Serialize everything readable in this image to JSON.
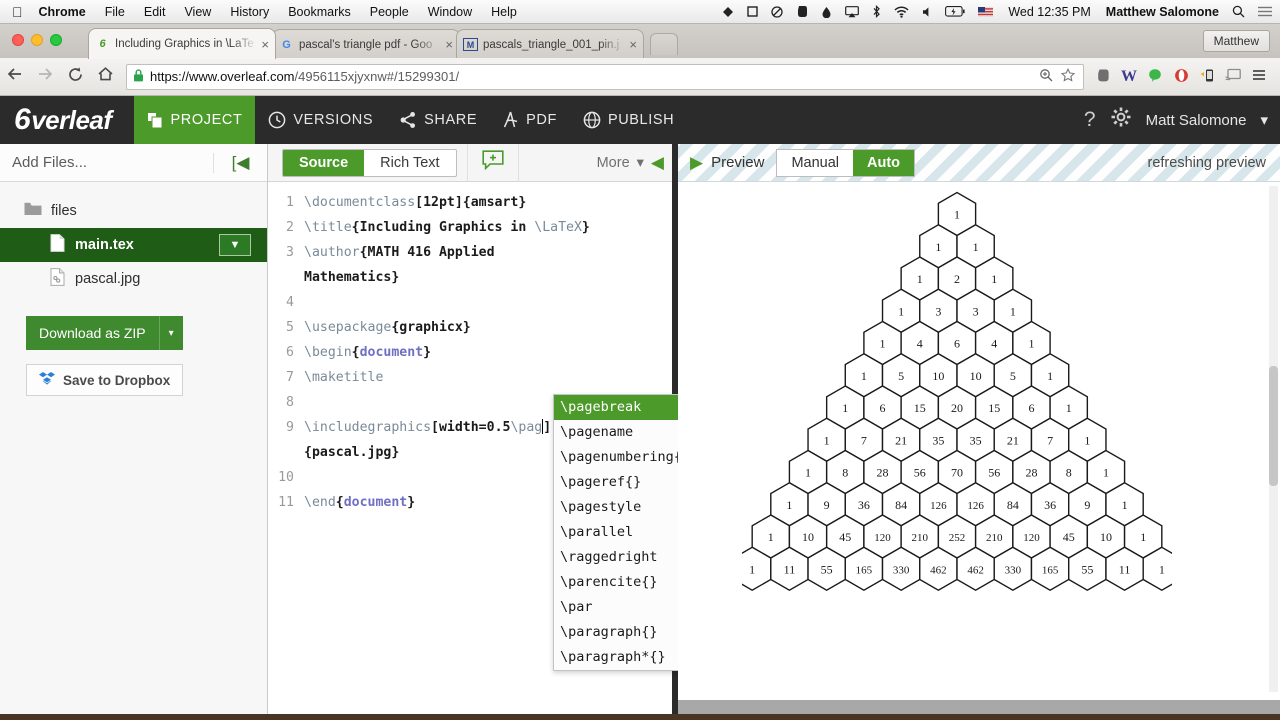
{
  "menubar": {
    "apple": "",
    "items": [
      {
        "label": "Chrome",
        "bold": true
      },
      {
        "label": "File"
      },
      {
        "label": "Edit"
      },
      {
        "label": "View"
      },
      {
        "label": "History"
      },
      {
        "label": "Bookmarks"
      },
      {
        "label": "People"
      },
      {
        "label": "Window"
      },
      {
        "label": "Help"
      }
    ],
    "status_icons": [
      {
        "name": "dropbox-icon",
        "glyph": "▲"
      },
      {
        "name": "square-icon",
        "glyph": "□"
      },
      {
        "name": "do-not-disturb-icon",
        "glyph": "⊘"
      },
      {
        "name": "evernote-icon",
        "glyph": "♛"
      },
      {
        "name": "droplet-icon",
        "glyph": "⬣"
      },
      {
        "name": "airplay-icon",
        "glyph": "⎕"
      },
      {
        "name": "bluetooth-icon",
        "glyph": "ᛦ"
      },
      {
        "name": "wifi-icon",
        "glyph": "◓"
      },
      {
        "name": "volume-icon",
        "glyph": "◂"
      },
      {
        "name": "battery-icon",
        "glyph": "[⚡]"
      },
      {
        "name": "input-flag-icon",
        "glyph": "⚑"
      }
    ],
    "clock": "Wed 12:35 PM",
    "user": "Matthew Salomone",
    "search_icon": "⚲",
    "notification_icon": "≡"
  },
  "browser": {
    "tabs": [
      {
        "title": "Including Graphics in \\LaTe",
        "favicon": "6",
        "active": true,
        "close": "×"
      },
      {
        "title": "pascal's triangle pdf - Goo",
        "favicon": "G",
        "active": false,
        "close": "×"
      },
      {
        "title": "pascals_triangle_001_pin.j",
        "favicon": "M",
        "active": false,
        "close": "×"
      }
    ],
    "profile_button": "Matthew",
    "nav": {
      "back": "←",
      "forward": "→",
      "reload": "↻",
      "home": "⌂"
    },
    "omnibox": {
      "lock_icon": "ὑ2",
      "url_domain": "https://www.overleaf.com",
      "url_path": "/4956115xjyxnw#/15299301/",
      "zoom_icon": "⊕",
      "bookmark_icon": "☆"
    },
    "extensions": [
      {
        "name": "evernote-extension-icon",
        "glyph": "♛",
        "color": "#6b6b6b"
      },
      {
        "name": "wikipedia-extension-icon",
        "glyph": "W",
        "color": "#3b3b8f"
      },
      {
        "name": "chat-bubble-extension-icon",
        "glyph": "●",
        "color": "#3cb54a"
      },
      {
        "name": "opera-extension-icon",
        "glyph": "●",
        "color": "#d93b30"
      },
      {
        "name": "mobile-extension-icon",
        "glyph": "▯",
        "color": "#555555"
      },
      {
        "name": "cast-extension-icon",
        "glyph": "⎕",
        "color": "#808080"
      },
      {
        "name": "chrome-menu-icon",
        "glyph": "≡",
        "color": "#555555"
      }
    ]
  },
  "overleaf": {
    "brand": "verleaf",
    "brand_mark": "6",
    "nav": [
      {
        "label": "PROJECT",
        "icon": "❐",
        "active": true
      },
      {
        "label": "VERSIONS",
        "icon": "◴",
        "active": false
      },
      {
        "label": "SHARE",
        "icon": "≪",
        "active": false
      },
      {
        "label": "PDF",
        "icon": "⅄",
        "active": false
      },
      {
        "label": "PUBLISH",
        "icon": "ἱ0",
        "active": false
      }
    ],
    "help_icon": "?",
    "settings_icon": "⚙",
    "account_name": "Matt Salomone",
    "account_caret": "▾"
  },
  "sidebar": {
    "add_files": "Add Files...",
    "collapse_icon": "[◀",
    "files": [
      {
        "name": "files",
        "type": "folder",
        "icon": "Ὄ1",
        "selected": false
      },
      {
        "name": "main.tex",
        "type": "file",
        "icon": "὜b",
        "selected": true,
        "caret": "▼"
      },
      {
        "name": "pascal.jpg",
        "type": "file",
        "icon": "὜e",
        "selected": false
      }
    ],
    "download_zip": "Download as ZIP",
    "download_caret": "▾",
    "save_dropbox": "Save to Dropbox",
    "dropbox_icon": "❖"
  },
  "editor": {
    "toolbar": {
      "source": "Source",
      "rich_text": "Rich Text",
      "comment_icon": "❐",
      "more": "More",
      "more_caret": "▾",
      "collapse_icon": "◀"
    },
    "lines": [
      {
        "num": "1",
        "segments": [
          {
            "t": "\\documentclass",
            "c": "cmd"
          },
          {
            "t": "[12pt]{amsart}",
            "c": "blk"
          }
        ]
      },
      {
        "num": "2",
        "segments": [
          {
            "t": "\\title",
            "c": "cmd"
          },
          {
            "t": "{Including Graphics in ",
            "c": "blk"
          },
          {
            "t": "\\LaTeX",
            "c": "cmd"
          },
          {
            "t": "}",
            "c": "blk"
          }
        ]
      },
      {
        "num": "3",
        "segments": [
          {
            "t": "\\author",
            "c": "cmd"
          },
          {
            "t": "{MATH 416 Applied",
            "c": "blk"
          }
        ]
      },
      {
        "num": "",
        "segments": [
          {
            "t": "Mathematics}",
            "c": "blk"
          }
        ]
      },
      {
        "num": "4",
        "segments": [
          {
            "t": "",
            "c": "blk"
          }
        ]
      },
      {
        "num": "5",
        "segments": [
          {
            "t": "\\usepackage",
            "c": "cmd"
          },
          {
            "t": "{graphicx}",
            "c": "blk"
          }
        ]
      },
      {
        "num": "6",
        "segments": [
          {
            "t": "\\begin",
            "c": "cmd"
          },
          {
            "t": "{",
            "c": "blk"
          },
          {
            "t": "document",
            "c": "kw"
          },
          {
            "t": "}",
            "c": "blk"
          }
        ]
      },
      {
        "num": "7",
        "segments": [
          {
            "t": "\\maketitle",
            "c": "cmd"
          }
        ]
      },
      {
        "num": "8",
        "segments": [
          {
            "t": "",
            "c": "blk"
          }
        ]
      },
      {
        "num": "9",
        "segments": [
          {
            "t": "\\includegraphics",
            "c": "cmd"
          },
          {
            "t": "[width=0.5",
            "c": "blk"
          },
          {
            "t": "\\pag",
            "c": "cmd"
          },
          {
            "t": "]",
            "c": "blk"
          }
        ]
      },
      {
        "num": "",
        "segments": [
          {
            "t": "{pascal.jpg}",
            "c": "blk"
          }
        ]
      },
      {
        "num": "10",
        "segments": [
          {
            "t": "",
            "c": "blk"
          }
        ]
      },
      {
        "num": "11",
        "segments": [
          {
            "t": "\\end",
            "c": "cmd"
          },
          {
            "t": "{",
            "c": "blk"
          },
          {
            "t": "document",
            "c": "kw"
          },
          {
            "t": "}",
            "c": "blk"
          }
        ]
      }
    ],
    "autocomplete": [
      {
        "label": "\\pagebreak",
        "selected": true
      },
      {
        "label": "\\pagename",
        "selected": false
      },
      {
        "label": "\\pagenumbering{",
        "selected": false
      },
      {
        "label": "\\pageref{}",
        "selected": false
      },
      {
        "label": "\\pagestyle",
        "selected": false
      },
      {
        "label": "\\parallel",
        "selected": false
      },
      {
        "label": "\\raggedright",
        "selected": false
      },
      {
        "label": "\\parencite{}",
        "selected": false
      },
      {
        "label": "\\par",
        "selected": false
      },
      {
        "label": "\\paragraph{}",
        "selected": false
      },
      {
        "label": "\\paragraph*{}",
        "selected": false
      }
    ]
  },
  "preview": {
    "play_icon": "▶",
    "label": "Preview",
    "manual": "Manual",
    "auto": "Auto",
    "status": "refreshing preview",
    "pascal_triangle": {
      "rows": [
        [
          1
        ],
        [
          1,
          1
        ],
        [
          1,
          2,
          1
        ],
        [
          1,
          3,
          3,
          1
        ],
        [
          1,
          4,
          6,
          4,
          1
        ],
        [
          1,
          5,
          10,
          10,
          5,
          1
        ],
        [
          1,
          6,
          15,
          20,
          15,
          6,
          1
        ],
        [
          1,
          7,
          21,
          35,
          35,
          21,
          7,
          1
        ],
        [
          1,
          8,
          28,
          56,
          70,
          56,
          28,
          8,
          1
        ],
        [
          1,
          9,
          36,
          84,
          126,
          126,
          84,
          36,
          9,
          1
        ],
        [
          1,
          10,
          45,
          120,
          210,
          252,
          210,
          120,
          45,
          10,
          1
        ],
        [
          1,
          11,
          55,
          165,
          330,
          462,
          462,
          330,
          165,
          55,
          11,
          1
        ]
      ]
    }
  },
  "colors": {
    "overleaf_green": "#4c9a2a",
    "dark_green": "#1f5c16",
    "header_dark": "#2b2b2b"
  }
}
